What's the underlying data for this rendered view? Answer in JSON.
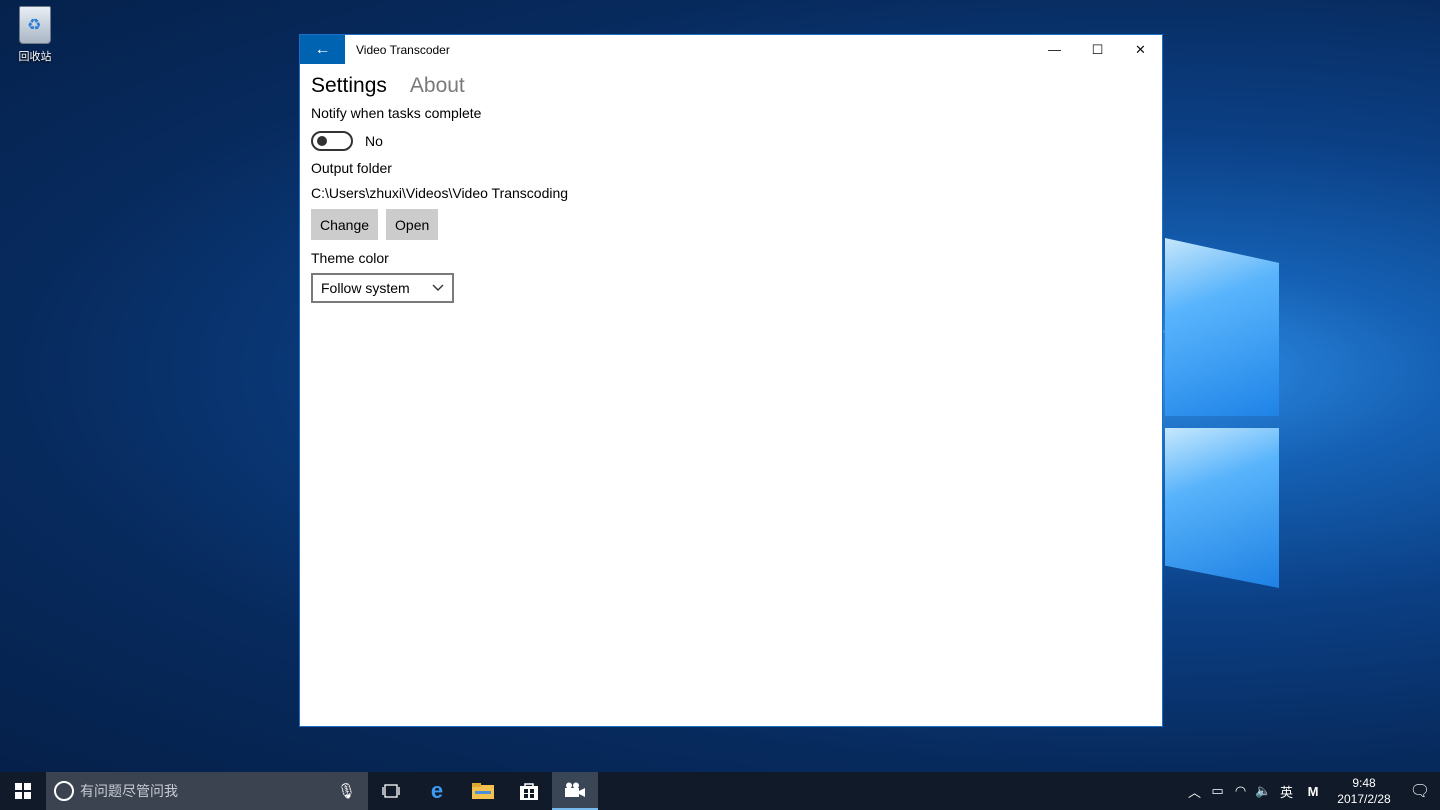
{
  "desktop": {
    "recycle_bin_label": "回收站"
  },
  "window": {
    "title": "Video Transcoder",
    "back_icon": "←",
    "minimize_icon": "—",
    "maximize_icon": "☐",
    "close_icon": "✕"
  },
  "tabs": [
    {
      "label": "Settings",
      "active": true
    },
    {
      "label": "About",
      "active": false
    }
  ],
  "settings": {
    "notify_label": "Notify when tasks complete",
    "notify_toggle_state": "No",
    "output_folder_label": "Output folder",
    "output_folder_path": "C:\\Users\\zhuxi\\Videos\\Video Transcoding",
    "change_button": "Change",
    "open_button": "Open",
    "theme_label": "Theme color",
    "theme_value": "Follow system"
  },
  "taskbar": {
    "search_placeholder": "有问题尽管问我",
    "ime_label": "英",
    "time": "9:48",
    "date": "2017/2/28"
  },
  "colors": {
    "accent": "#0063b1",
    "taskbar": "#101a28",
    "button_bg": "#cccccc"
  }
}
